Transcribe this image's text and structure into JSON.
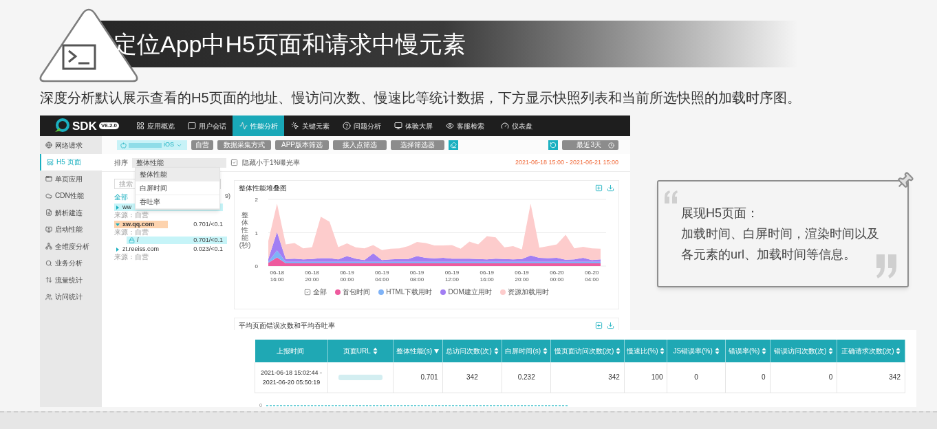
{
  "slide": {
    "title": "定位App中H5页面和请求中慢元素",
    "subtitle": "深度分析默认展示查看的H5页面的地址、慢访问次数、慢速比等统计数据，下方显示快照列表和当前所选快照的加载时序图。"
  },
  "app": {
    "logo_text": "SDK",
    "version": "V6.2.0",
    "nav": [
      {
        "label": "应用概览",
        "selected": false
      },
      {
        "label": "用户会话",
        "selected": false
      },
      {
        "label": "性能分析",
        "selected": true
      },
      {
        "label": "关键元素",
        "selected": false
      },
      {
        "label": "问题分析",
        "selected": false
      },
      {
        "label": "体验大屏",
        "selected": false
      },
      {
        "label": "客服检索",
        "selected": false
      },
      {
        "label": "仪表盘",
        "selected": false
      }
    ],
    "sidebar": [
      {
        "label": "网络请求",
        "selected": false
      },
      {
        "label": "H5 页面",
        "selected": true
      },
      {
        "label": "单页应用",
        "selected": false
      },
      {
        "label": "CDN性能",
        "selected": false
      },
      {
        "label": "解析建连",
        "selected": false
      },
      {
        "label": "启动性能",
        "selected": false
      },
      {
        "label": "全维度分析",
        "selected": false
      },
      {
        "label": "业务分析",
        "selected": false
      },
      {
        "label": "流量统计",
        "selected": false
      },
      {
        "label": "访问统计",
        "selected": false
      }
    ],
    "filters": {
      "platform": "iOS",
      "buttons": [
        "自营",
        "数据采集方式",
        "APP版本筛选",
        "接入点筛选",
        "选择筛选器"
      ],
      "date_preset": "最近3天",
      "date_range": "2021-06-18 15:00 - 2021-06-21 15:00"
    },
    "sort": {
      "label": "排序",
      "value": "整体性能",
      "options": [
        {
          "label": "整体性能",
          "selected": true
        },
        {
          "label": "白屏时间",
          "selected": false
        },
        {
          "label": "吞吐率",
          "selected": false
        }
      ],
      "hide_low": {
        "label": "隐藏小于1%曝光率",
        "checked": true
      }
    },
    "page_list": {
      "search_placeholder": "搜索",
      "all_label": "全部",
      "count": "9)",
      "items": [
        {
          "name": "ww",
          "expanded": false,
          "color": "#c6f4f8",
          "source": "来源：自营"
        },
        {
          "name": "xw.qq.com",
          "expanded": true,
          "value": "0.701/<0.1",
          "color": "#fdd3ae",
          "source": "来源：自营",
          "children": [
            {
              "name": "/",
              "value": "0.701/<0.1",
              "color": "#c6f4f8"
            }
          ]
        },
        {
          "name": "zt.reeiss.com",
          "expanded": false,
          "value": "0.023/<0.1",
          "source": "来源：自营"
        }
      ]
    },
    "chart_panel": {
      "legend_all": "全部",
      "chart_data": {
        "type": "area",
        "stacked": true,
        "title": "整体性能堆叠图",
        "ylabel": "整体性能(秒)",
        "ylim": [
          0,
          2
        ],
        "yticks": [
          0,
          1,
          2
        ],
        "categories": [
          null,
          "06-18 16:00",
          null,
          null,
          null,
          "06-18 20:00",
          null,
          null,
          null,
          "06-19 00:00",
          null,
          null,
          null,
          "06-19 04:00",
          null,
          null,
          null,
          "06-19 08:00",
          null,
          null,
          null,
          "06-19 12:00",
          null,
          null,
          null,
          "06-19 16:00",
          null,
          null,
          null,
          "06-19 20:00",
          null,
          null,
          null,
          "06-20 00:00",
          null,
          null,
          null,
          "06-20 04:00",
          null
        ],
        "series": [
          {
            "name": "首包时间",
            "color": "#ee5a9e",
            "values": [
              0.1,
              0.26,
              0.08,
              0.08,
              0.08,
              0.08,
              0.08,
              0.08,
              0.08,
              0.08,
              0.08,
              0.08,
              0.08,
              0.08,
              0.08,
              0.08,
              0.08,
              0.08,
              0.08,
              0.08,
              0.08,
              0.08,
              0.08,
              0.08,
              0.08,
              0.08,
              0.08,
              0.08,
              0.08,
              0.08,
              0.08,
              0.08,
              0.08,
              0.08,
              0.08,
              0.08,
              0.08,
              0.08,
              0.08
            ]
          },
          {
            "name": "HTML下载用时",
            "color": "#7fb3f7",
            "values": [
              0.03,
              0.21,
              0.05,
              0.05,
              0.05,
              0.05,
              0.05,
              0.05,
              0.05,
              0.05,
              0.05,
              0.05,
              0.05,
              0.05,
              0.05,
              0.05,
              0.05,
              0.05,
              0.05,
              0.05,
              0.05,
              0.05,
              0.05,
              0.05,
              0.05,
              0.05,
              0.05,
              0.05,
              0.05,
              0.05,
              0.05,
              0.05,
              0.05,
              0.05,
              0.05,
              0.05,
              0.05,
              0.05,
              0.05
            ]
          },
          {
            "name": "DOM建立用时",
            "color": "#a27ef3",
            "values": [
              0.08,
              0.55,
              0.08,
              0.09,
              0.07,
              0.08,
              0.11,
              0.11,
              0.07,
              0.17,
              0.09,
              0.05,
              0.25,
              0.05,
              0.07,
              0.08,
              0.08,
              0.17,
              0.12,
              0.1,
              0.12,
              0.09,
              0.09,
              0.09,
              0.08,
              0.07,
              0.09,
              0.08,
              0.07,
              0.08,
              0.19,
              0.12,
              0.11,
              0.12,
              0.06,
              0.07,
              0.12,
              0.05,
              0.07
            ]
          },
          {
            "name": "资源加载用时",
            "color": "#fdcccc",
            "values": [
              0.54,
              0.85,
              0.44,
              0.47,
              0.33,
              0.36,
              1.24,
              1.09,
              0.37,
              0.38,
              0.34,
              0.35,
              0.25,
              0.3,
              0.32,
              0.32,
              0.39,
              0.42,
              0.44,
              0.39,
              0.37,
              0.41,
              0.3,
              0.51,
              0.44,
              0.7,
              0.64,
              0.35,
              0.4,
              0.29,
              1.55,
              0.3,
              0.36,
              0.4,
              0.75,
              0.33,
              0.33,
              0.35,
              0.32
            ]
          }
        ]
      }
    },
    "error_panel": {
      "title": "平均页面错误次数和平均吞吐率",
      "axis_zero": "0"
    },
    "table": {
      "columns": [
        {
          "label": "上报时间",
          "sortable": false
        },
        {
          "label": "页面URL",
          "sortable": true,
          "sorted": false
        },
        {
          "label": "整体性能(s)",
          "sortable": true,
          "sorted": true
        },
        {
          "label": "总访问次数(次)",
          "sortable": true,
          "sorted": false
        },
        {
          "label": "白屏时间(s)",
          "sortable": true,
          "sorted": false
        },
        {
          "label": "慢页面访问次数(次)",
          "sortable": true,
          "sorted": false
        },
        {
          "label": "慢速比(%)",
          "sortable": true,
          "sorted": false
        },
        {
          "label": "JS错误率(%)",
          "sortable": true,
          "sorted": false
        },
        {
          "label": "错误率(%)",
          "sortable": true,
          "sorted": false
        },
        {
          "label": "错误访问次数(次)",
          "sortable": true,
          "sorted": false
        },
        {
          "label": "正确请求次数(次)",
          "sortable": true,
          "sorted": false
        }
      ],
      "rows": [
        {
          "cells": [
            "2021-06-18 15:02:44 - 2021-06-20 05:50:19",
            "",
            "0.701",
            "342",
            "0.232",
            "342",
            "100",
            "0",
            "0",
            "0",
            "342"
          ]
        }
      ]
    }
  },
  "callout": {
    "heading": "展现H5页面：",
    "lines": [
      "加载时间、白屏时间，渲染时间以及",
      "各元素的url、加载时间等信息。"
    ]
  }
}
